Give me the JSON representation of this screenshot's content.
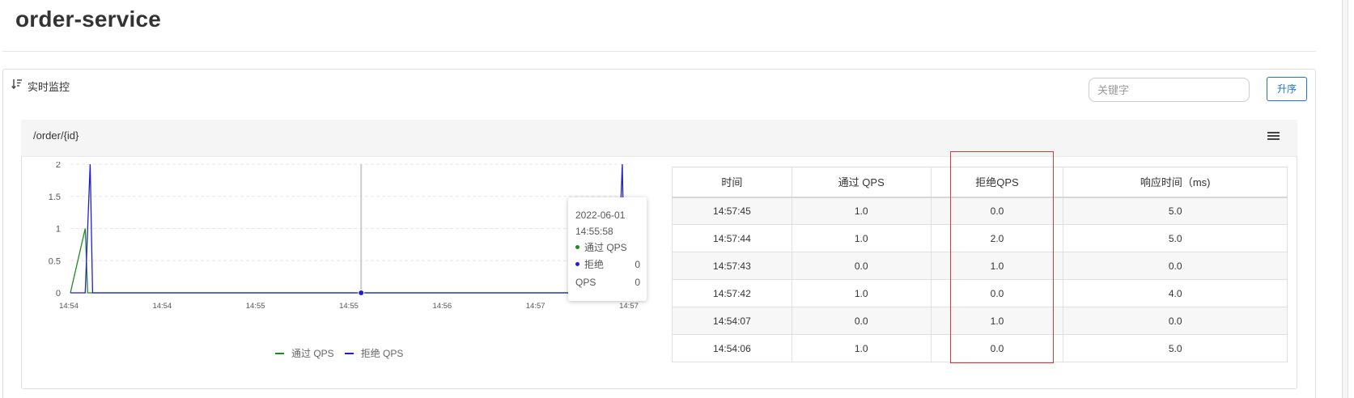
{
  "page": {
    "title": "order-service"
  },
  "panel": {
    "title": "实时监控",
    "search_placeholder": "关键字",
    "sort_label": "升序"
  },
  "resource": {
    "name": "/order/{id}"
  },
  "icons": {
    "sort": "sort-descending-icon",
    "menu": "hamburger-menu-icon"
  },
  "colors": {
    "pass": "#1e8a1e",
    "block": "#1f1fcc",
    "accent": "#1a73c8",
    "highlight": "#d9363e"
  },
  "chart_data": {
    "type": "line",
    "x": [
      "14:54:00",
      "14:54:06",
      "14:54:07",
      "14:54:08",
      "14:54:09",
      "14:55:58",
      "14:57:41",
      "14:57:42",
      "14:57:43",
      "14:57:44",
      "14:57:45",
      "14:57:46"
    ],
    "series": [
      {
        "name": "通过 QPS",
        "values": [
          0,
          1,
          0,
          0,
          0,
          0,
          0,
          1,
          0,
          1,
          1,
          0
        ]
      },
      {
        "name": "拒绝 QPS",
        "values": [
          0,
          0,
          1,
          2,
          0,
          0,
          0,
          0,
          1,
          2,
          0,
          0
        ]
      }
    ],
    "y_ticks": [
      "0",
      "0.5",
      "1",
      "1.5",
      "2"
    ],
    "x_ticks": [
      "14:54",
      "14:54",
      "14:55",
      "14:55",
      "14:56",
      "14:57",
      "14:57"
    ],
    "ylim": [
      0,
      2
    ],
    "grid": true,
    "legend": "bottom",
    "hover_point": {
      "x": "14:55:58",
      "y": 0
    }
  },
  "tooltip": {
    "date": "2022-06-01",
    "time": "14:55:58",
    "pass_label": "通过 QPS",
    "block_label_1": "拒绝",
    "block_label_2": "QPS",
    "pass_value": "0",
    "block_value": "0"
  },
  "legend": {
    "pass": "通过 QPS",
    "block": "拒绝 QPS"
  },
  "table": {
    "headers": [
      "时间",
      "通过 QPS",
      "拒绝QPS",
      "响应时间（ms)"
    ],
    "rows": [
      [
        "14:57:45",
        "1.0",
        "0.0",
        "5.0"
      ],
      [
        "14:57:44",
        "1.0",
        "2.0",
        "5.0"
      ],
      [
        "14:57:43",
        "0.0",
        "1.0",
        "0.0"
      ],
      [
        "14:57:42",
        "1.0",
        "0.0",
        "4.0"
      ],
      [
        "14:54:07",
        "0.0",
        "1.0",
        "0.0"
      ],
      [
        "14:54:06",
        "1.0",
        "0.0",
        "5.0"
      ]
    ]
  }
}
